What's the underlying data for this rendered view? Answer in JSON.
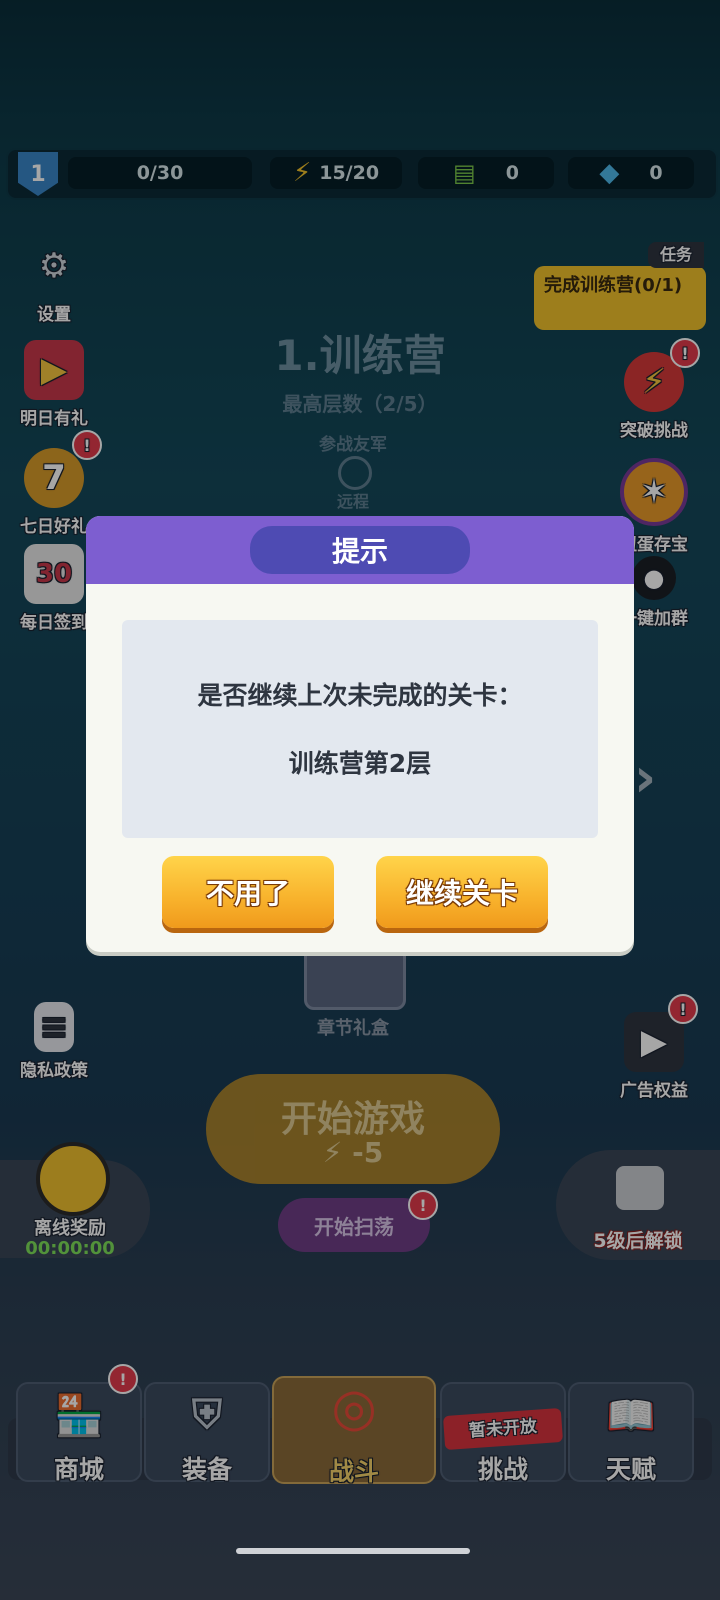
{
  "resources": {
    "level": "1",
    "exp": "0/30",
    "energy": "15/20",
    "cash": "0",
    "gems": "0"
  },
  "left_menu": {
    "settings": "设置",
    "tomorrow_gift": "明日有礼",
    "seven_day": "七日好礼",
    "daily_signin": "每日签到",
    "privacy": "隐私政策",
    "offline_reward": "离线奖励",
    "offline_timer": "00:00:00"
  },
  "right_menu": {
    "task_tag": "任务",
    "task_text": "完成训练营(0/1)",
    "breakthrough": "突破挑战",
    "egg_treasure": "扭蛋存宝",
    "join_group": "一键加群",
    "ad_rights": "广告权益",
    "unlock_hint": "5级后解锁"
  },
  "stage": {
    "title": "1.训练营",
    "max_floor": "最高层数（2/5）",
    "ally_label": "参战友军",
    "ranged_label": "远程",
    "chapter_gift": "章节礼盒"
  },
  "dialog": {
    "title": "提示",
    "message": "是否继续上次未完成的关卡：",
    "stage_name": "训练营第2层",
    "cancel_label": "不用了",
    "continue_label": "继续关卡"
  },
  "actions": {
    "start_game": "开始游戏",
    "energy_cost": "-5",
    "sweep": "开始扫荡"
  },
  "bottom_nav": {
    "shop": "商城",
    "equipment": "装备",
    "battle": "战斗",
    "challenge": "挑战",
    "challenge_badge": "暂未开放",
    "talent": "天赋"
  },
  "badge_mark": "!",
  "colors": {
    "dialog_header": "#7d5ed0",
    "button_yellow": "#f8b22c",
    "badge_red": "#e23b4c"
  }
}
